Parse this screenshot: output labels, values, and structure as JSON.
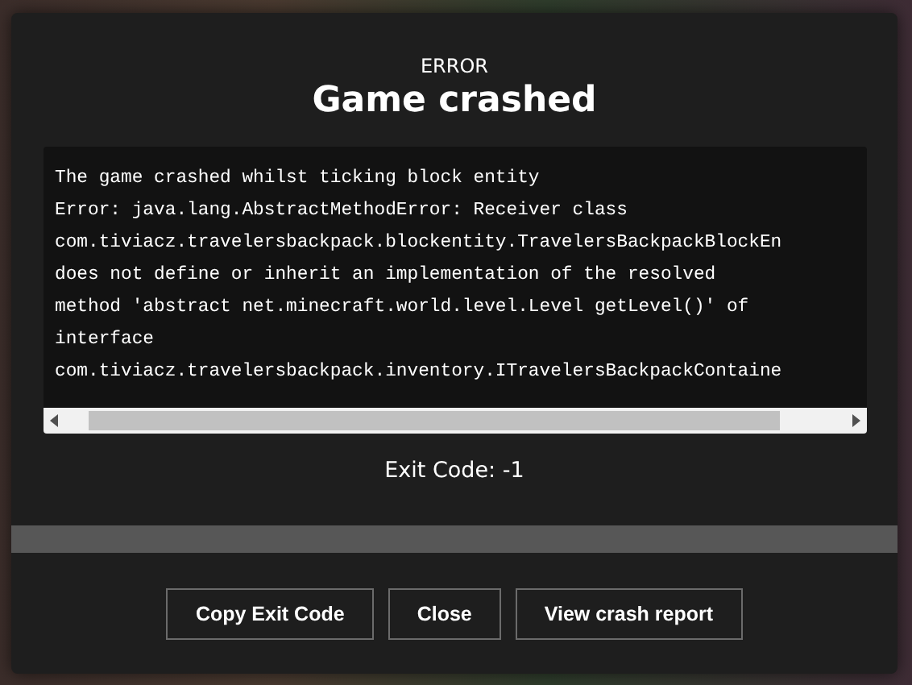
{
  "dialog": {
    "kicker": "ERROR",
    "title": "Game crashed",
    "log_lines": [
      "The game crashed whilst ticking block entity",
      "Error: java.lang.AbstractMethodError: Receiver class",
      "com.tiviacz.travelersbackpack.blockentity.TravelersBackpackBlockEn",
      "does not define or inherit an implementation of the resolved",
      "method 'abstract net.minecraft.world.level.Level getLevel()' of",
      "interface",
      "com.tiviacz.travelersbackpack.inventory.ITravelersBackpackContaine"
    ],
    "exit_code": "Exit Code: -1",
    "buttons": [
      "Copy Exit Code",
      "Close",
      "View crash report"
    ]
  }
}
